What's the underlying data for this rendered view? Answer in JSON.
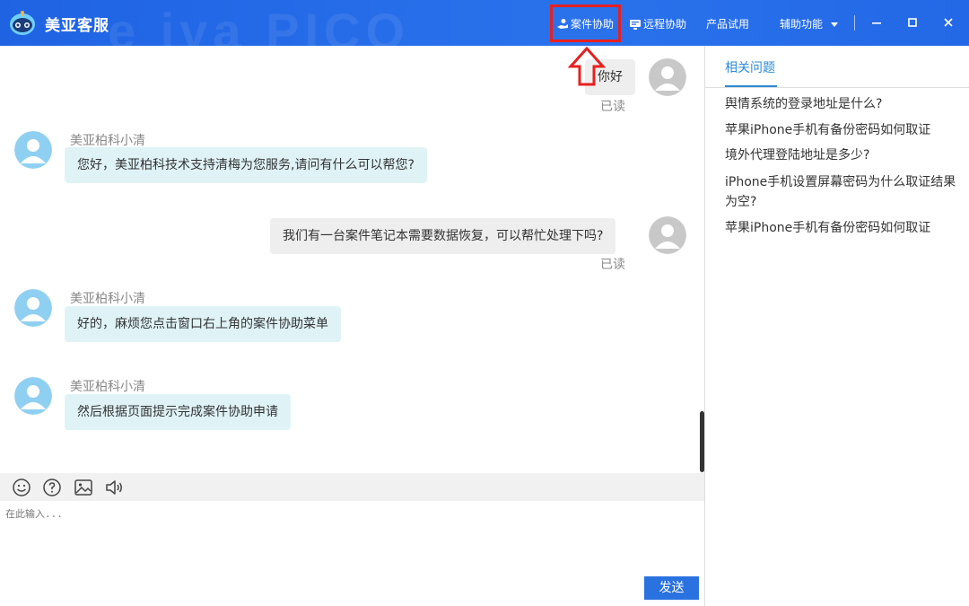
{
  "app": {
    "title": "美亚客服",
    "watermark": "e iva PICO"
  },
  "header": {
    "nav": {
      "case_assist": "案件协助",
      "remote_assist": "远程协助",
      "product_trial": "产品试用",
      "aux_functions": "辅助功能"
    }
  },
  "colors": {
    "titlebar": "#2368e6",
    "highlight": "#e62020",
    "agent_bubble": "#dff3f7",
    "user_bubble": "#eeeeee",
    "accent": "#2a8bd6",
    "send": "#2a72e0"
  },
  "chat": {
    "messages": [
      {
        "from": "user",
        "text": "你好",
        "status": "已读"
      },
      {
        "from": "agent",
        "sender": "美亚柏科小清",
        "text": "您好，美亚柏科技术支持清梅为您服务,请问有什么可以帮您?"
      },
      {
        "from": "user",
        "text": "我们有一台案件笔记本需要数据恢复，可以帮忙处理下吗?",
        "status": "已读"
      },
      {
        "from": "agent",
        "sender": "美亚柏科小清",
        "text": "好的，麻烦您点击窗口右上角的案件协助菜单"
      },
      {
        "from": "agent",
        "sender": "美亚柏科小清",
        "text": "然后根据页面提示完成案件协助申请"
      }
    ]
  },
  "toolbar": {
    "icons": [
      "emoji-icon",
      "help-icon",
      "image-icon",
      "sound-icon"
    ]
  },
  "input": {
    "placeholder": "在此输入..."
  },
  "send": {
    "label": "发送"
  },
  "side": {
    "tab": "相关问题",
    "questions": [
      "舆情系统的登录地址是什么?",
      "苹果iPhone手机有备份密码如何取证",
      "境外代理登陆地址是多少?",
      "iPhone手机设置屏幕密码为什么取证结果为空?",
      "苹果iPhone手机有备份密码如何取证"
    ]
  }
}
